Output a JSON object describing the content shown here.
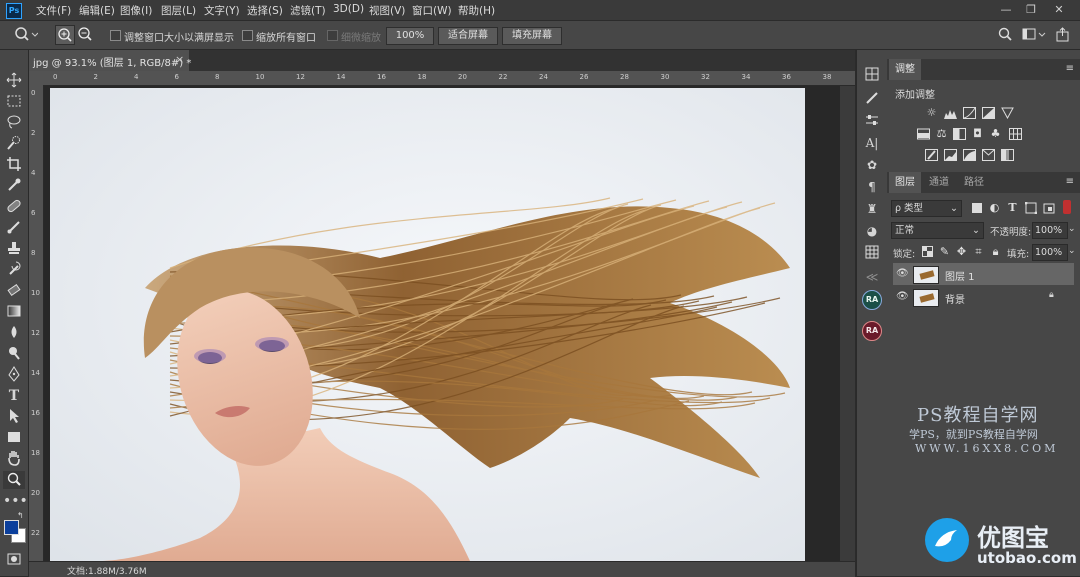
{
  "app": {
    "logo": "Ps"
  },
  "menu": [
    "文件(F)",
    "编辑(E)",
    "图像(I)",
    "图层(L)",
    "文字(Y)",
    "选择(S)",
    "滤镜(T)",
    "3D(D)",
    "视图(V)",
    "窗口(W)",
    "帮助(H)"
  ],
  "window_controls": {
    "minimize": "—",
    "restore": "❐",
    "close": "✕"
  },
  "options": {
    "resize_windows_label": "调整窗口大小以满屏显示",
    "zoom_all_windows_label": "缩放所有窗口",
    "scrubby_zoom_label": "细微缩放",
    "zoom_percent": "100%",
    "fit_screen_label": "适合屏幕",
    "fill_screen_label": "填充屏幕"
  },
  "document": {
    "tab_title": "jpg @ 93.1% (图层 1, RGB/8#) *",
    "close": "×",
    "ruler_ticks": [
      "0",
      "2",
      "4",
      "6",
      "8",
      "10",
      "12",
      "14",
      "16",
      "18",
      "20",
      "22",
      "24",
      "26",
      "28",
      "30",
      "32",
      "34",
      "36",
      "38"
    ],
    "status": "文档:1.88M/3.76M"
  },
  "tools": [
    "move",
    "marquee",
    "lasso",
    "quick-select",
    "crop",
    "eyedropper",
    "healing",
    "brush",
    "stamp",
    "history-brush",
    "eraser",
    "gradient",
    "blur",
    "dodge",
    "pen",
    "type",
    "path-select",
    "shape",
    "hand",
    "zoom",
    "more"
  ],
  "right_minibar": {
    "ra1": "RA",
    "ra2": "RA"
  },
  "adjustments_panel": {
    "tab": "调整",
    "heading": "添加调整"
  },
  "layers_panel": {
    "tabs": [
      "图层",
      "通道",
      "路径"
    ],
    "filter_kind": "ρ 类型",
    "blend_mode": "正常",
    "opacity_label": "不透明度:",
    "opacity_value": "100%",
    "lock_label": "锁定:",
    "fill_label": "填充:",
    "fill_value": "100%",
    "layers": [
      {
        "name": "图层 1",
        "selected": true,
        "locked": false
      },
      {
        "name": "背景",
        "selected": false,
        "locked": true
      }
    ]
  },
  "watermark": {
    "title": "PS教程自学网",
    "subtitle": "学PS，就到PS教程自学网",
    "url": "WWW.16XX8.COM",
    "brand_cn": "优图宝",
    "brand_url": "utobao.com"
  },
  "colors": {
    "accent": "#31a8ff",
    "foreground_swatch": "#0b3f9c",
    "background_swatch": "#ffffff",
    "hair": "#9a6a30"
  }
}
